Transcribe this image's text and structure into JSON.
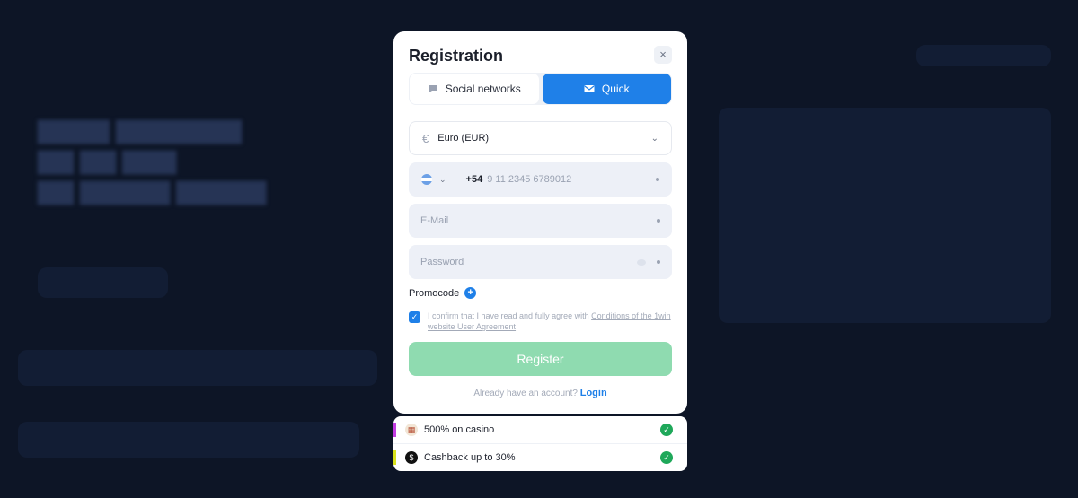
{
  "modal": {
    "title": "Registration",
    "close_icon": "×",
    "tabs": [
      {
        "label": "Social networks",
        "icon": "chat-bubble-icon",
        "active": false
      },
      {
        "label": "Quick",
        "icon": "envelope-icon",
        "active": true
      }
    ],
    "currency": {
      "symbol": "€",
      "value": "Euro (EUR)"
    },
    "phone": {
      "country_code": "+54",
      "placeholder": "9 11 2345 6789012"
    },
    "email": {
      "placeholder": "E-Mail"
    },
    "password": {
      "placeholder": "Password"
    },
    "promocode_label": "Promocode",
    "agreement": {
      "checked": true,
      "text": "I confirm that I have read and fully agree with ",
      "link": "Conditions of the 1win website User Agreement"
    },
    "register_label": "Register",
    "login_prompt": "Already have an account?",
    "login_link": "Login"
  },
  "bonuses": [
    {
      "label": "500% on casino",
      "icon": "casino-icon",
      "accent": "#c13be0"
    },
    {
      "label": "Cashback up to 30%",
      "icon": "cashback-icon",
      "accent": "#d9e21c"
    }
  ],
  "colors": {
    "primary": "#1f80e8",
    "register_disabled": "#8fdbb0",
    "success": "#1fa85a"
  }
}
